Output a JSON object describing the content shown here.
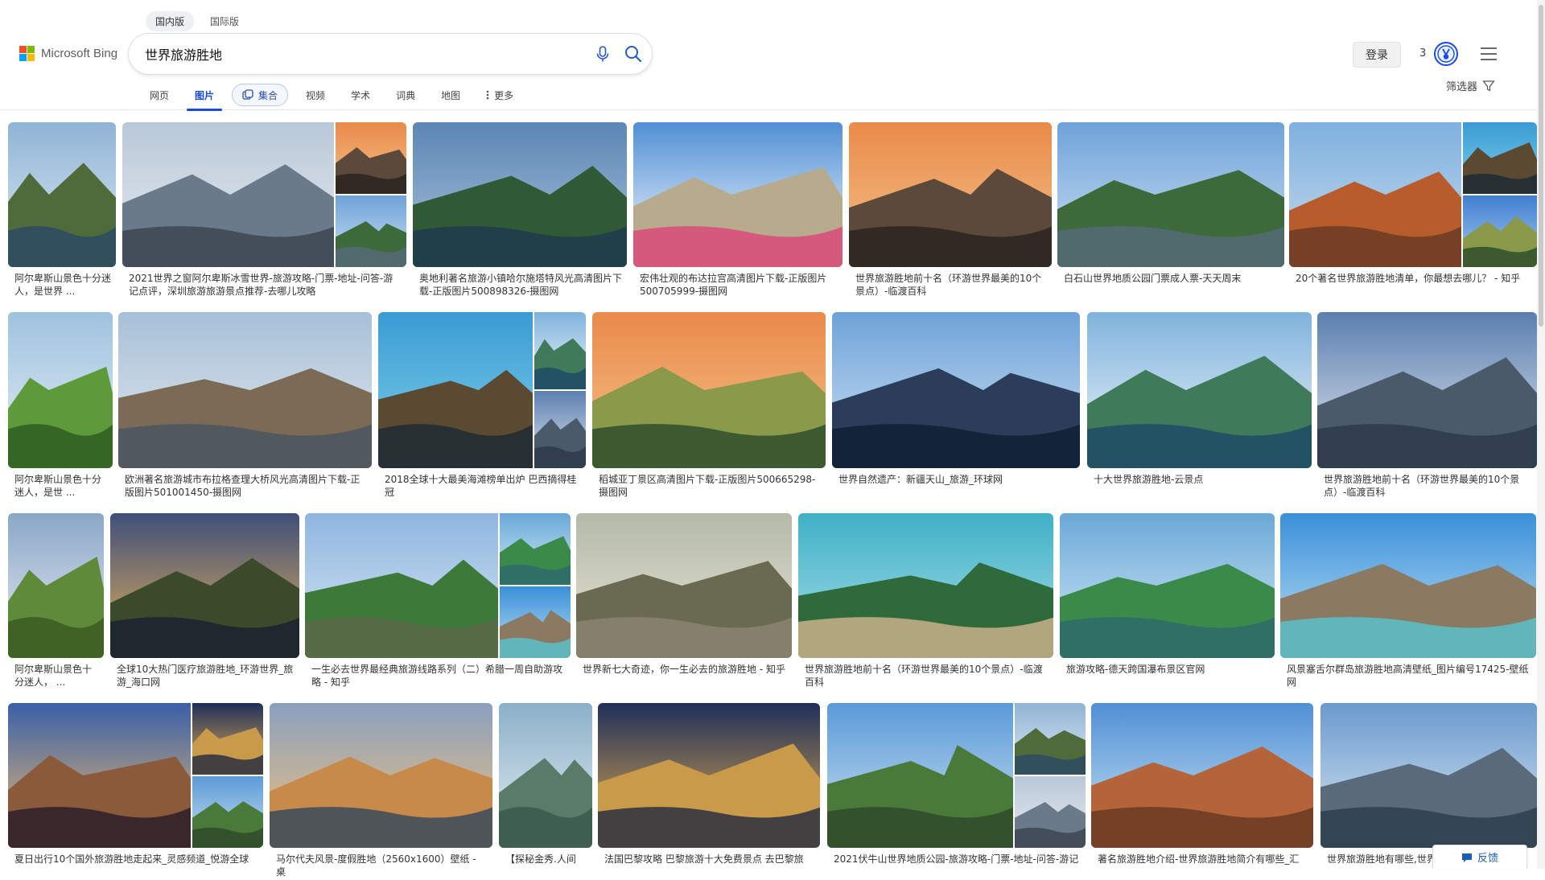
{
  "region_tabs": [
    "国内版",
    "国际版"
  ],
  "brand": {
    "name": "Microsoft Bing",
    "logo_colors": [
      "#f25022",
      "#7fba00",
      "#00a4ef",
      "#ffb900"
    ]
  },
  "search": {
    "query": "世界旅游胜地",
    "placeholder": ""
  },
  "header": {
    "login_label": "登录",
    "rewards_count": "3",
    "accent": "#174ae4"
  },
  "nav": {
    "items": [
      "网页",
      "图片",
      "集合",
      "视频",
      "学术",
      "词典",
      "地图",
      "更多"
    ],
    "active": "图片",
    "filter_label": "筛选器"
  },
  "results": [
    {
      "caption": "阿尔卑斯山景色十分迷人，是世界 ..."
    },
    {
      "caption": "2021世界之窗阿尔卑斯冰雪世界-旅游攻略-门票-地址-问答-游记点评，深圳旅游旅游景点推荐-去哪儿攻略"
    },
    {
      "caption": "奥地利著名旅游小镇哈尔施塔特风光高清图片下载-正版图片500898326-摄图网"
    },
    {
      "caption": "宏伟壮观的布达拉宫高清图片下载-正版图片500705999-摄图网"
    },
    {
      "caption": "世界旅游胜地前十名（环游世界最美的10个景点）-临渡百科"
    },
    {
      "caption": "白石山世界地质公园门票成人票-天天周末"
    },
    {
      "caption": "20个著名世界旅游胜地清单，你最想去哪儿？ - 知乎"
    },
    {
      "caption": "阿尔卑斯山景色十分迷人，是世 ..."
    },
    {
      "caption": "欧洲著名旅游城市布拉格查理大桥风光高清图片下载-正版图片501001450-摄图网"
    },
    {
      "caption": "2018全球十大最美海滩榜单出炉 巴西摘得桂冠"
    },
    {
      "caption": "稻城亚丁景区高清图片下载-正版图片500665298-摄图网"
    },
    {
      "caption": "世界自然遗产：新疆天山_旅游_环球网"
    },
    {
      "caption": "十大世界旅游胜地-云景点"
    },
    {
      "caption": "世界旅游胜地前十名（环游世界最美的10个景点）-临渡百科"
    },
    {
      "caption": "阿尔卑斯山景色十分迷人， ..."
    },
    {
      "caption": "全球10大热门医疗旅游胜地_环游世界_旅游_海口网"
    },
    {
      "caption": "一生必去世界最经典旅游线路系列（二）希腊一周自助游攻略 - 知乎"
    },
    {
      "caption": "世界新七大奇迹，你一生必去的旅游胜地 - 知乎"
    },
    {
      "caption": "世界旅游胜地前十名（环游世界最美的10个景点）-临渡百科"
    },
    {
      "caption": "旅游攻略-德天跨国瀑布景区官网"
    },
    {
      "caption": "风景塞舌尔群岛旅游胜地高清壁纸_图片编号17425-壁纸网"
    },
    {
      "caption": "夏日出行10个国外旅游胜地走起来_灵感频道_悦游全球"
    },
    {
      "caption": "马尔代夫风景-度假胜地（2560x1600）壁纸 - 桌"
    },
    {
      "caption": "【探秘金秀.人间"
    },
    {
      "caption": "法国巴黎攻略 巴黎旅游十大免费景点 去巴黎旅"
    },
    {
      "caption": "2021伏牛山世界地质公园-旅游攻略-门票-地址-问答-游记"
    },
    {
      "caption": "著名旅游胜地介绍-世界旅游胜地简介有哪些_汇"
    },
    {
      "caption": "世界旅游胜地有哪些,世界"
    }
  ],
  "feedback_label": "反馈"
}
